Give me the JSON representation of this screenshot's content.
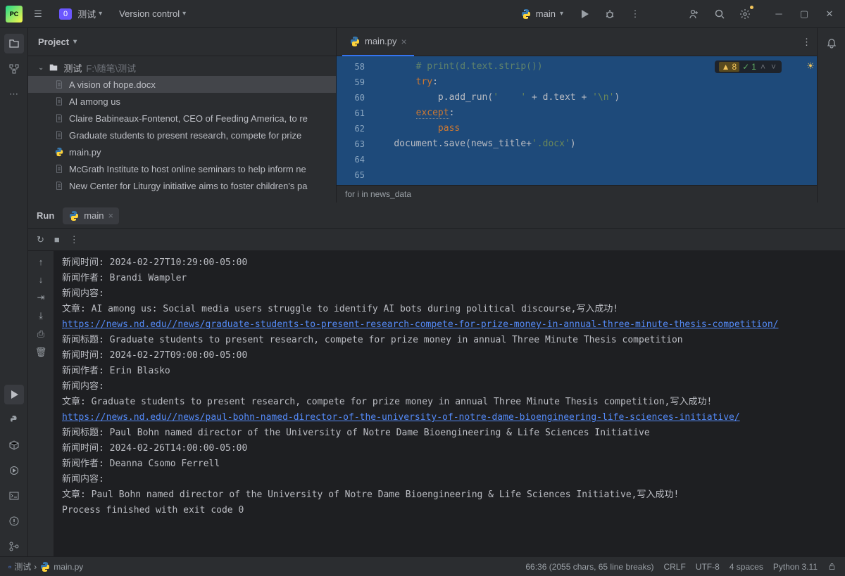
{
  "titlebar": {
    "project_badge": "0",
    "project_name": "测试",
    "vcs_label": "Version control",
    "run_config": "main"
  },
  "project": {
    "header": "Project",
    "root_name": "测试",
    "root_path": "F:\\随笔\\测试",
    "files": [
      "A vision of hope.docx",
      "AI among us",
      "Claire Babineaux-Fontenot, CEO of Feeding America, to re",
      "Graduate students to present research, compete for prize",
      "main.py",
      "McGrath Institute to host online seminars to help inform ne",
      "New Center for Liturgy initiative aims to foster children's pa"
    ]
  },
  "editor": {
    "tab_label": "main.py",
    "breadcrumb": "for i in news_data",
    "warn_count": "8",
    "tick_count": "1",
    "lines": [
      {
        "num": "58",
        "indent": "        ",
        "seg": [
          {
            "cls": "c-comment",
            "t": "# print(d.text.strip())"
          }
        ]
      },
      {
        "num": "59",
        "indent": "        ",
        "seg": [
          {
            "cls": "c-keyword",
            "t": "try"
          },
          {
            "cls": "c-text",
            "t": ":"
          }
        ]
      },
      {
        "num": "60",
        "indent": "            ",
        "seg": [
          {
            "cls": "c-text",
            "t": "p.add_run("
          },
          {
            "cls": "c-string",
            "t": "'    '"
          },
          {
            "cls": "c-text",
            "t": " + d.text + "
          },
          {
            "cls": "c-string",
            "t": "'\\n'"
          },
          {
            "cls": "c-text",
            "t": ")"
          }
        ]
      },
      {
        "num": "61",
        "indent": "        ",
        "seg": [
          {
            "cls": "c-keyword c-underline",
            "t": "except"
          },
          {
            "cls": "c-text",
            "t": ":"
          }
        ]
      },
      {
        "num": "62",
        "indent": "            ",
        "seg": [
          {
            "cls": "c-keyword",
            "t": "pass"
          }
        ]
      },
      {
        "num": "63",
        "indent": "",
        "seg": []
      },
      {
        "num": "64",
        "indent": "    ",
        "seg": [
          {
            "cls": "c-text",
            "t": "document.save(news_title+"
          },
          {
            "cls": "c-string",
            "t": "'.docx'"
          },
          {
            "cls": "c-text",
            "t": ")"
          }
        ]
      },
      {
        "num": "65",
        "indent": "",
        "seg": []
      }
    ]
  },
  "run": {
    "panel_label": "Run",
    "tab_label": "main",
    "lines": [
      "新闻时间: 2024-02-27T10:29:00-05:00",
      "新闻作者: Brandi Wampler",
      "新闻内容:",
      "文章: AI among us: Social media users struggle to identify AI bots during political discourse,写入成功!",
      {
        "link": "https://news.nd.edu//news/graduate-students-to-present-research-compete-for-prize-money-in-annual-three-minute-thesis-competition/"
      },
      "新闻标题: Graduate students to present research, compete for prize money in annual Three Minute Thesis competition",
      "新闻时间: 2024-02-27T09:00:00-05:00",
      "新闻作者: Erin Blasko",
      "新闻内容:",
      "文章: Graduate students to present research, compete for prize money in annual Three Minute Thesis competition,写入成功!",
      {
        "link": "https://news.nd.edu//news/paul-bohn-named-director-of-the-university-of-notre-dame-bioengineering-life-sciences-initiative/"
      },
      "新闻标题: Paul Bohn named director of the University of Notre Dame Bioengineering & Life Sciences Initiative",
      "新闻时间: 2024-02-26T14:00:00-05:00",
      "新闻作者: Deanna Csomo Ferrell",
      "新闻内容:",
      "文章: Paul Bohn named director of the University of Notre Dame Bioengineering & Life Sciences Initiative,写入成功!",
      "",
      "Process finished with exit code 0"
    ]
  },
  "statusbar": {
    "breadcrumb_root": "测试",
    "breadcrumb_file": "main.py",
    "position": "66:36 (2055 chars, 65 line breaks)",
    "eol": "CRLF",
    "encoding": "UTF-8",
    "indent": "4 spaces",
    "interpreter": "Python 3.11"
  }
}
